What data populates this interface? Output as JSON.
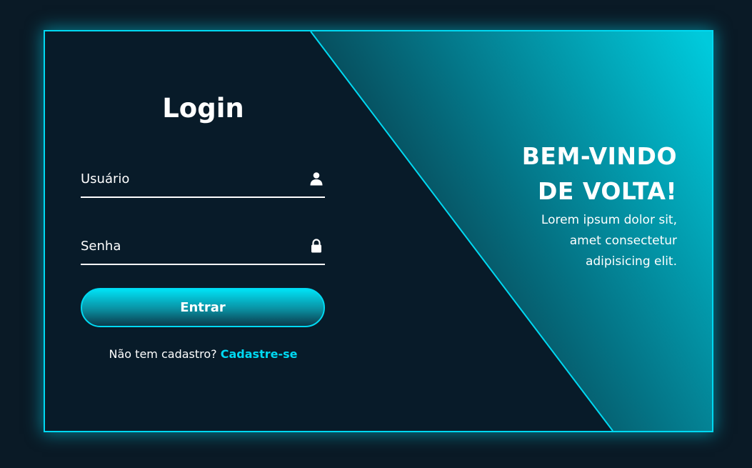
{
  "login": {
    "title": "Login",
    "username_placeholder": "Usuário",
    "password_placeholder": "Senha",
    "submit_label": "Entrar",
    "register_prompt": "Não tem cadastro?",
    "register_link": "Cadastre-se"
  },
  "welcome": {
    "title_line1": "BEM-VINDO",
    "title_line2": "DE VOLTA!",
    "text_line1": "Lorem ipsum dolor sit,",
    "text_line2": "amet consectetur",
    "text_line3": "adipisicing elit."
  },
  "icons": {
    "username": "user-icon",
    "password": "lock-icon"
  },
  "colors": {
    "background": "#0a1a26",
    "panel": "#081b29",
    "accent": "#00d9f2",
    "accent_dark": "#0b4d5f"
  }
}
